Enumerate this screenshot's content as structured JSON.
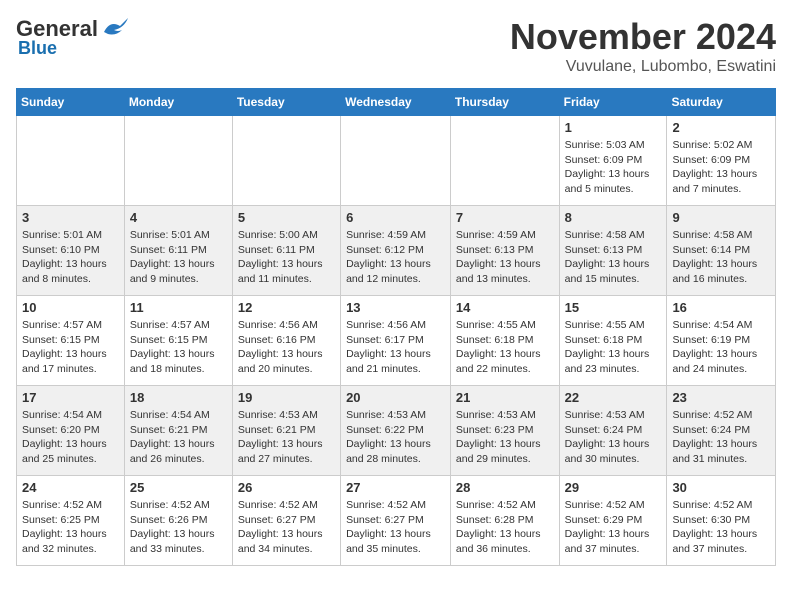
{
  "logo": {
    "general": "General",
    "blue": "Blue"
  },
  "title": "November 2024",
  "location": "Vuvulane, Lubombo, Eswatini",
  "weekdays": [
    "Sunday",
    "Monday",
    "Tuesday",
    "Wednesday",
    "Thursday",
    "Friday",
    "Saturday"
  ],
  "weeks": [
    [
      {
        "day": "",
        "info": ""
      },
      {
        "day": "",
        "info": ""
      },
      {
        "day": "",
        "info": ""
      },
      {
        "day": "",
        "info": ""
      },
      {
        "day": "",
        "info": ""
      },
      {
        "day": "1",
        "info": "Sunrise: 5:03 AM\nSunset: 6:09 PM\nDaylight: 13 hours and 5 minutes."
      },
      {
        "day": "2",
        "info": "Sunrise: 5:02 AM\nSunset: 6:09 PM\nDaylight: 13 hours and 7 minutes."
      }
    ],
    [
      {
        "day": "3",
        "info": "Sunrise: 5:01 AM\nSunset: 6:10 PM\nDaylight: 13 hours and 8 minutes."
      },
      {
        "day": "4",
        "info": "Sunrise: 5:01 AM\nSunset: 6:11 PM\nDaylight: 13 hours and 9 minutes."
      },
      {
        "day": "5",
        "info": "Sunrise: 5:00 AM\nSunset: 6:11 PM\nDaylight: 13 hours and 11 minutes."
      },
      {
        "day": "6",
        "info": "Sunrise: 4:59 AM\nSunset: 6:12 PM\nDaylight: 13 hours and 12 minutes."
      },
      {
        "day": "7",
        "info": "Sunrise: 4:59 AM\nSunset: 6:13 PM\nDaylight: 13 hours and 13 minutes."
      },
      {
        "day": "8",
        "info": "Sunrise: 4:58 AM\nSunset: 6:13 PM\nDaylight: 13 hours and 15 minutes."
      },
      {
        "day": "9",
        "info": "Sunrise: 4:58 AM\nSunset: 6:14 PM\nDaylight: 13 hours and 16 minutes."
      }
    ],
    [
      {
        "day": "10",
        "info": "Sunrise: 4:57 AM\nSunset: 6:15 PM\nDaylight: 13 hours and 17 minutes."
      },
      {
        "day": "11",
        "info": "Sunrise: 4:57 AM\nSunset: 6:15 PM\nDaylight: 13 hours and 18 minutes."
      },
      {
        "day": "12",
        "info": "Sunrise: 4:56 AM\nSunset: 6:16 PM\nDaylight: 13 hours and 20 minutes."
      },
      {
        "day": "13",
        "info": "Sunrise: 4:56 AM\nSunset: 6:17 PM\nDaylight: 13 hours and 21 minutes."
      },
      {
        "day": "14",
        "info": "Sunrise: 4:55 AM\nSunset: 6:18 PM\nDaylight: 13 hours and 22 minutes."
      },
      {
        "day": "15",
        "info": "Sunrise: 4:55 AM\nSunset: 6:18 PM\nDaylight: 13 hours and 23 minutes."
      },
      {
        "day": "16",
        "info": "Sunrise: 4:54 AM\nSunset: 6:19 PM\nDaylight: 13 hours and 24 minutes."
      }
    ],
    [
      {
        "day": "17",
        "info": "Sunrise: 4:54 AM\nSunset: 6:20 PM\nDaylight: 13 hours and 25 minutes."
      },
      {
        "day": "18",
        "info": "Sunrise: 4:54 AM\nSunset: 6:21 PM\nDaylight: 13 hours and 26 minutes."
      },
      {
        "day": "19",
        "info": "Sunrise: 4:53 AM\nSunset: 6:21 PM\nDaylight: 13 hours and 27 minutes."
      },
      {
        "day": "20",
        "info": "Sunrise: 4:53 AM\nSunset: 6:22 PM\nDaylight: 13 hours and 28 minutes."
      },
      {
        "day": "21",
        "info": "Sunrise: 4:53 AM\nSunset: 6:23 PM\nDaylight: 13 hours and 29 minutes."
      },
      {
        "day": "22",
        "info": "Sunrise: 4:53 AM\nSunset: 6:24 PM\nDaylight: 13 hours and 30 minutes."
      },
      {
        "day": "23",
        "info": "Sunrise: 4:52 AM\nSunset: 6:24 PM\nDaylight: 13 hours and 31 minutes."
      }
    ],
    [
      {
        "day": "24",
        "info": "Sunrise: 4:52 AM\nSunset: 6:25 PM\nDaylight: 13 hours and 32 minutes."
      },
      {
        "day": "25",
        "info": "Sunrise: 4:52 AM\nSunset: 6:26 PM\nDaylight: 13 hours and 33 minutes."
      },
      {
        "day": "26",
        "info": "Sunrise: 4:52 AM\nSunset: 6:27 PM\nDaylight: 13 hours and 34 minutes."
      },
      {
        "day": "27",
        "info": "Sunrise: 4:52 AM\nSunset: 6:27 PM\nDaylight: 13 hours and 35 minutes."
      },
      {
        "day": "28",
        "info": "Sunrise: 4:52 AM\nSunset: 6:28 PM\nDaylight: 13 hours and 36 minutes."
      },
      {
        "day": "29",
        "info": "Sunrise: 4:52 AM\nSunset: 6:29 PM\nDaylight: 13 hours and 37 minutes."
      },
      {
        "day": "30",
        "info": "Sunrise: 4:52 AM\nSunset: 6:30 PM\nDaylight: 13 hours and 37 minutes."
      }
    ]
  ]
}
